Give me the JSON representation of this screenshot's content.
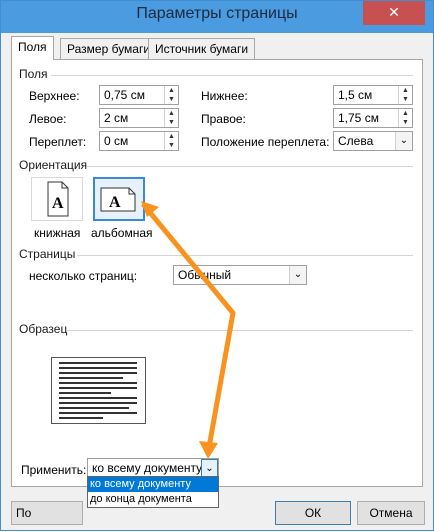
{
  "window": {
    "title": "Параметры страницы",
    "close_glyph": "✕"
  },
  "tabs": [
    {
      "label": "Поля",
      "active": true
    },
    {
      "label": "Размер бумаги",
      "active": false
    },
    {
      "label": "Источник бумаги",
      "active": false
    }
  ],
  "margins": {
    "group_label": "Поля",
    "top": {
      "label": "Верхнее:",
      "value": "0,75 см"
    },
    "left": {
      "label": "Левое:",
      "value": "2 см"
    },
    "gutter": {
      "label": "Переплет:",
      "value": "0 см"
    },
    "bottom": {
      "label": "Нижнее:",
      "value": "1,5 см"
    },
    "right": {
      "label": "Правое:",
      "value": "1,75 см"
    },
    "gutter_position": {
      "label": "Положение переплета:",
      "value": "Слева"
    }
  },
  "orientation": {
    "group_label": "Ориентация",
    "portrait": {
      "label": "книжная",
      "glyph": "A"
    },
    "landscape": {
      "label": "альбомная",
      "glyph": "A",
      "selected": true
    }
  },
  "pages": {
    "group_label": "Страницы",
    "multiple_label": "несколько страниц:",
    "multiple_value": "Обычный"
  },
  "preview": {
    "group_label": "Образец"
  },
  "apply": {
    "label": "Применить:",
    "value": "ко всему документу",
    "options": [
      "ко всему документу",
      "до конца документа"
    ]
  },
  "buttons": {
    "default_label": "По умолчанию",
    "ok_label": "ОК",
    "cancel_label": "Отмена"
  },
  "colors": {
    "title_bar": "#4a9be0",
    "close_button": "#c75050",
    "selection": "#0078d7",
    "annotation_arrow": "#f7931e"
  }
}
